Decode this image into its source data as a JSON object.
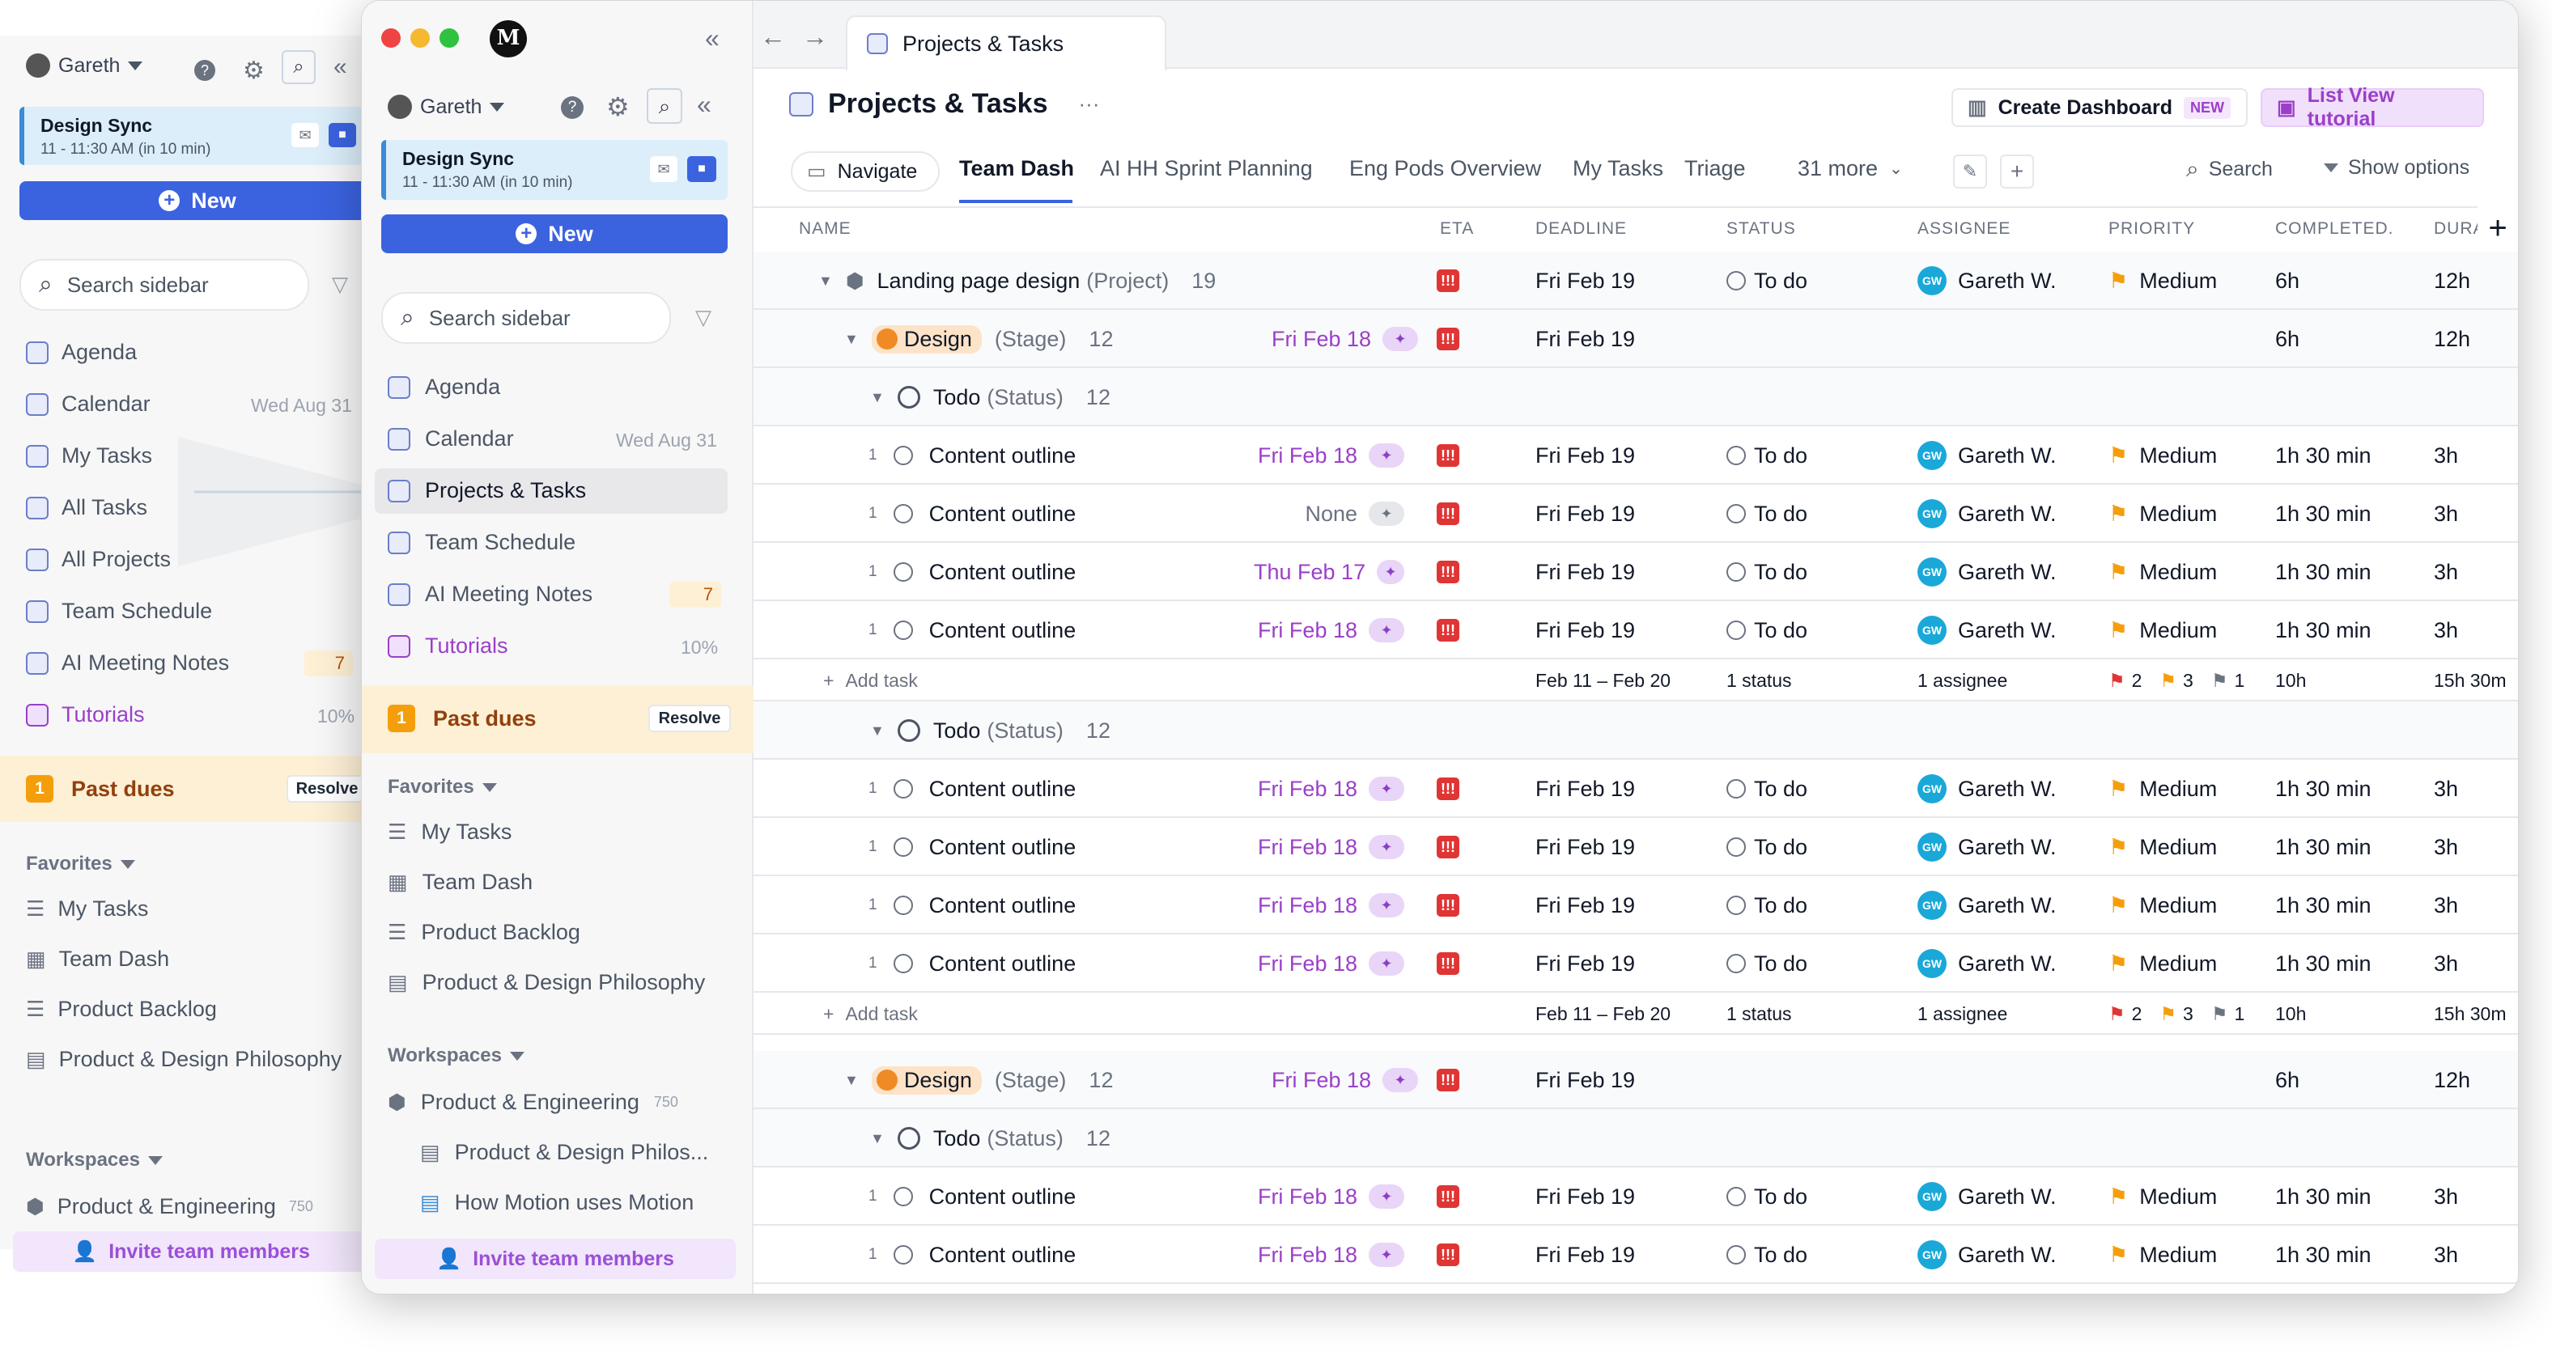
{
  "back_sidebar": {
    "user": "Gareth",
    "meeting_title": "Design Sync",
    "meeting_time": "11 - 11:30 AM (in 10 min)",
    "new_label": "New",
    "search_placeholder": "Search sidebar",
    "items": [
      {
        "label": "Agenda",
        "meta": ""
      },
      {
        "label": "Calendar",
        "meta": "Wed Aug 31"
      },
      {
        "label": "My Tasks",
        "meta": ""
      },
      {
        "label": "All Tasks",
        "meta": ""
      },
      {
        "label": "All Projects",
        "meta": ""
      },
      {
        "label": "Team Schedule",
        "meta": ""
      },
      {
        "label": "AI Meeting Notes",
        "meta": "7"
      },
      {
        "label": "Tutorials",
        "meta": "10%"
      }
    ],
    "past_dues_count": "1",
    "past_dues_label": "Past dues",
    "resolve_label": "Resolve",
    "favorites_label": "Favorites",
    "favorites": [
      "My Tasks",
      "Team Dash",
      "Product Backlog",
      "Product & Design Philosophy"
    ],
    "workspaces_label": "Workspaces",
    "workspace": "Product & Engineering",
    "workspace_count": "750",
    "invite_label": "Invite team members"
  },
  "sidebar": {
    "user": "Gareth",
    "meeting_title": "Design Sync",
    "meeting_time": "11 - 11:30 AM (in 10 min)",
    "new_label": "New",
    "search_placeholder": "Search sidebar",
    "items": [
      {
        "label": "Agenda",
        "meta": ""
      },
      {
        "label": "Calendar",
        "meta": "Wed Aug 31"
      },
      {
        "label": "Projects & Tasks",
        "meta": ""
      },
      {
        "label": "Team Schedule",
        "meta": ""
      },
      {
        "label": "AI Meeting Notes",
        "meta": "7"
      },
      {
        "label": "Tutorials",
        "meta": "10%"
      }
    ],
    "past_dues_count": "1",
    "past_dues_label": "Past dues",
    "resolve_label": "Resolve",
    "favorites_label": "Favorites",
    "favorites": [
      "My Tasks",
      "Team Dash",
      "Product Backlog",
      "Product & Design Philosophy"
    ],
    "workspaces_label": "Workspaces",
    "workspace": "Product & Engineering",
    "workspace_count": "750",
    "workspace_children": [
      "Product & Design Philos...",
      "How Motion uses Motion"
    ],
    "invite_label": "Invite team members"
  },
  "tab": {
    "title": "Projects & Tasks"
  },
  "header": {
    "title": "Projects & Tasks",
    "more": "···",
    "create_dashboard": "Create Dashboard",
    "new_badge": "NEW",
    "tutorial": "List View tutorial"
  },
  "views": {
    "navigate": "Navigate",
    "tabs": [
      "Team Dash",
      "AI HH Sprint Planning",
      "Eng Pods Overview",
      "My Tasks",
      "Triage"
    ],
    "more": "31 more",
    "search": "Search",
    "show_options": "Show options"
  },
  "columns": [
    "NAME",
    "ETA",
    "DEADLINE",
    "STATUS",
    "ASSIGNEE",
    "PRIORITY",
    "COMPLETED...",
    "DURA"
  ],
  "project": {
    "name": "Landing page design",
    "type": "(Project)",
    "count": "19",
    "deadline": "Fri Feb 19",
    "status": "To do",
    "assignee": "Gareth W.",
    "avatar": "GW",
    "priority": "Medium",
    "completed": "6h",
    "duration": "12h"
  },
  "stage_label": "Design",
  "stage_type": "(Stage)",
  "stage_count": "12",
  "stage_date": "Fri Feb 18",
  "stage_deadline": "Fri Feb 19",
  "stage_completed": "6h",
  "stage_duration": "12h",
  "status_group": {
    "name": "Todo",
    "type": "(Status)",
    "count": "12"
  },
  "task": {
    "name": "Content outline",
    "deadline": "Fri Feb 19",
    "status": "To do",
    "assignee": "Gareth W.",
    "avatar": "GW",
    "priority": "Medium",
    "completed": "1h 30 min",
    "duration": "3h",
    "num": "1"
  },
  "group1_dates": [
    "Fri Feb 18",
    "None",
    "Thu Feb 17",
    "Fri Feb 18"
  ],
  "group2_dates": [
    "Fri Feb 18",
    "Fri Feb 18",
    "Fri Feb 18",
    "Fri Feb 18"
  ],
  "group3_dates": [
    "Fri Feb 18",
    "Fri Feb 18"
  ],
  "summary": {
    "add_task": "Add task",
    "range": "Feb 11 – Feb 20",
    "status": "1 status",
    "assignee": "1 assignee",
    "p_high": "2",
    "p_med": "3",
    "p_low": "1",
    "completed": "10h",
    "duration": "15h 30m"
  },
  "colors": {
    "accent": "#3b63e0",
    "purple": "#9b3fc9",
    "danger": "#e03535",
    "orange": "#f08a24"
  }
}
